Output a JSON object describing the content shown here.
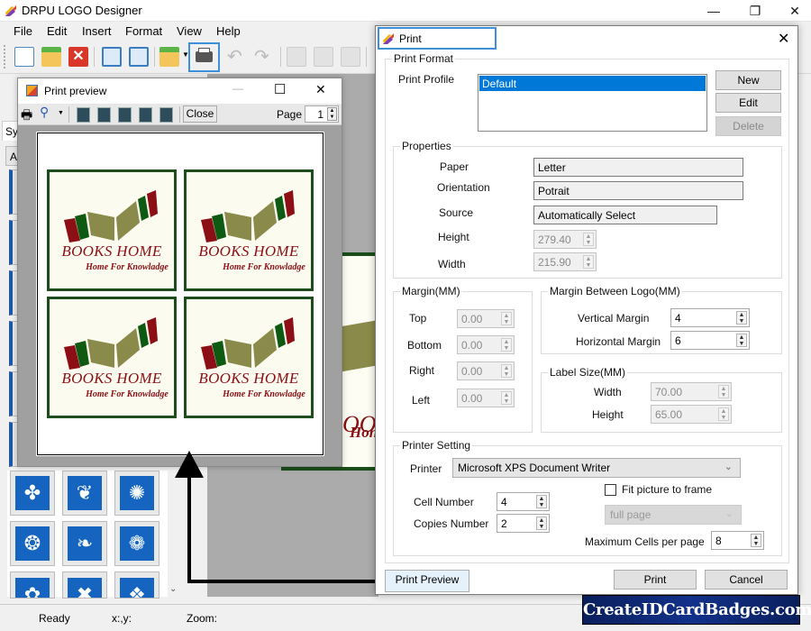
{
  "app": {
    "title": "DRPU LOGO Designer",
    "menu": [
      "File",
      "Edit",
      "Insert",
      "Format",
      "View",
      "Help"
    ],
    "toolbar_icons": [
      "new-document-icon",
      "open-folder-icon",
      "close-red-x-icon",
      "save-icon",
      "save-as-icon",
      "open-recent-icon",
      "print-icon",
      "undo-icon",
      "redo-icon",
      "cut-icon",
      "copy-icon",
      "paste-icon"
    ],
    "sidebar_tab": "Sy",
    "sidebar_subtab": "A",
    "window_controls": {
      "minimize": "—",
      "maximize": "❐",
      "close": "✕"
    }
  },
  "print_preview": {
    "title": "Print preview",
    "close_label": "Close",
    "page_label": "Page",
    "page_value": "1",
    "window_controls": {
      "minimize": "—",
      "maximize": "☐",
      "close": "✕"
    },
    "labels": [
      {
        "title": "BOOKS HOME",
        "subtitle": "Home For Knowladge"
      },
      {
        "title": "BOOKS HOME",
        "subtitle": "Home For Knowladge"
      },
      {
        "title": "BOOKS HOME",
        "subtitle": "Home For Knowladge"
      },
      {
        "title": "BOOKS HOME",
        "subtitle": "Home For Knowladge"
      }
    ],
    "logo_colors": {
      "maroon": "#8b0f14",
      "green": "#0f5a12",
      "olive": "#8a8a4a",
      "border": "#1d4d1d"
    }
  },
  "print_dialog": {
    "title": "Print",
    "close": "✕",
    "print_format": {
      "group_title": "Print Format",
      "profile_label": "Print Profile",
      "profiles": [
        "Default"
      ],
      "selected_profile": "Default",
      "new_label": "New",
      "edit_label": "Edit",
      "delete_label": "Delete"
    },
    "properties": {
      "group_title": "Properties",
      "paper_label": "Paper",
      "paper_value": "Letter",
      "orientation_label": "Orientation",
      "orientation_value": "Potrait",
      "source_label": "Source",
      "source_value": "Automatically Select",
      "height_label": "Height",
      "height_value": "279.40",
      "width_label": "Width",
      "width_value": "215.90"
    },
    "margin": {
      "group_title": "Margin(MM)",
      "top_label": "Top",
      "top_value": "0.00",
      "bottom_label": "Bottom",
      "bottom_value": "0.00",
      "right_label": "Right",
      "right_value": "0.00",
      "left_label": "Left",
      "left_value": "0.00"
    },
    "margin_between": {
      "group_title": "Margin Between Logo(MM)",
      "vertical_label": "Vertical Margin",
      "vertical_value": "4",
      "horizontal_label": "Horizontal Margin",
      "horizontal_value": "6"
    },
    "label_size": {
      "group_title": "Label Size(MM)",
      "width_label": "Width",
      "width_value": "70.00",
      "height_label": "Height",
      "height_value": "65.00"
    },
    "printer_setting": {
      "group_title": "Printer Setting",
      "printer_label": "Printer",
      "printer_value": "Microsoft XPS Document Writer",
      "fit_label": "Fit picture to frame",
      "fit_checked": false,
      "fit_mode": "full page",
      "cell_label": "Cell Number",
      "cell_value": "4",
      "copies_label": "Copies Number",
      "copies_value": "2",
      "max_cells_label": "Maximum Cells per page",
      "max_cells_value": "8"
    },
    "print_preview_label": "Print Preview",
    "print_label": "Print",
    "cancel_label": "Cancel"
  },
  "status": {
    "ready": "Ready",
    "coords": "x:,y:",
    "zoom": "Zoom:"
  },
  "watermark": "CreateIDCardBadges.com",
  "sidebar_symbols": [
    "✤",
    "❦",
    "✺",
    "❂",
    "❧",
    "❁",
    "✿",
    "✖",
    "❖"
  ]
}
